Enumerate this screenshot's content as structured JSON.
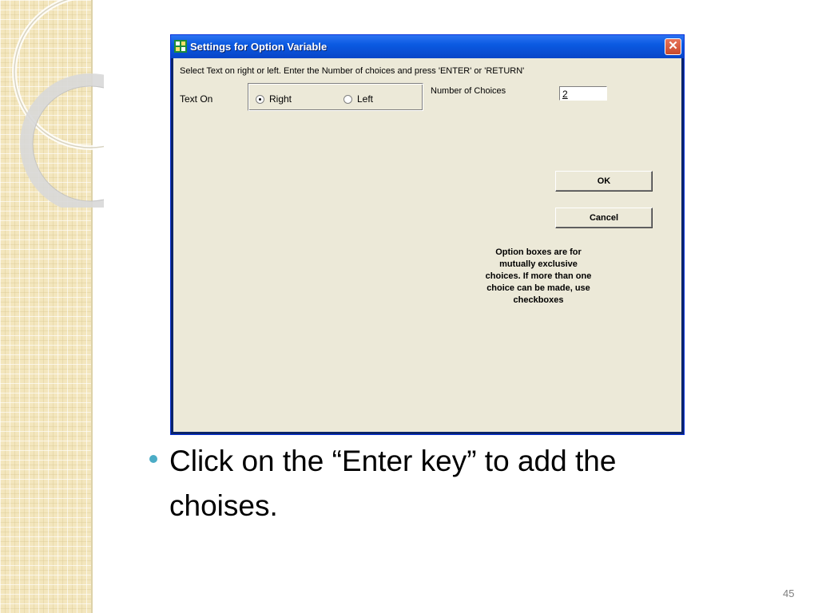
{
  "dialog": {
    "title": "Settings for Option Variable",
    "close_symbol": "✕",
    "instruction": "Select Text on right or left. Enter the Number of choices and press  'ENTER' or 'RETURN'",
    "text_on_label": "Text  On",
    "options": [
      {
        "label": "Right",
        "selected": true
      },
      {
        "label": "Left",
        "selected": false
      }
    ],
    "num_choices_label": "Number of Choices",
    "num_choices_value": "2",
    "ok_label": "OK",
    "cancel_label": "Cancel",
    "hint_text": "Option boxes are for\nmutually exclusive\nchoices. If more than one\nchoice can be made, use\ncheckboxes"
  },
  "slide": {
    "bullet_text": "Click on the “Enter key” to add the choises.",
    "page_number": "45",
    "accent_color": "#4bacc6"
  },
  "icons": {
    "app": "app-icon",
    "close": "close-icon",
    "bullet": "bullet-icon"
  }
}
